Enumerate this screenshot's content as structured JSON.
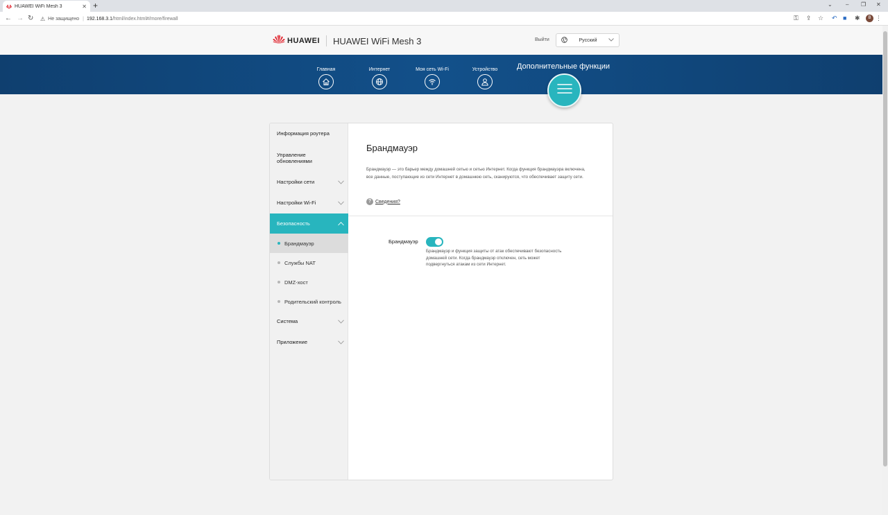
{
  "browser": {
    "tab_title": "HUAWEI WiFi Mesh 3",
    "new_tab": "+",
    "not_secure": "Не защищено",
    "url_host": "192.168.3.1",
    "url_path": "/html/index.html#/more/firewall",
    "profile_initial": "В"
  },
  "header": {
    "brand": "HUAWEI",
    "product": "HUAWEI WiFi Mesh 3",
    "logout": "Выйти",
    "language": "Русский"
  },
  "nav": {
    "items": [
      {
        "label": "Главная",
        "icon": "home-icon"
      },
      {
        "label": "Интернет",
        "icon": "globe-icon"
      },
      {
        "label": "Моя сеть Wi-Fi",
        "icon": "wifi-icon"
      },
      {
        "label": "Устройство",
        "icon": "user-icon"
      }
    ],
    "active": {
      "label": "Дополнительные функции",
      "icon": "menu-icon"
    }
  },
  "sidebar": {
    "items": [
      {
        "label": "Информация роутера",
        "expandable": false
      },
      {
        "label": "Управление обновлениями",
        "expandable": false
      },
      {
        "label": "Настройки сети",
        "expandable": true
      },
      {
        "label": "Настройки Wi-Fi",
        "expandable": true
      },
      {
        "label": "Безопасность",
        "expandable": true,
        "expanded": true,
        "active": true
      },
      {
        "label": "Система",
        "expandable": true
      },
      {
        "label": "Приложение",
        "expandable": true
      }
    ],
    "security_subitems": [
      {
        "label": "Брандмауэр",
        "active": true
      },
      {
        "label": "Службы NAT"
      },
      {
        "label": "DMZ-хост"
      },
      {
        "label": "Родительский контроль"
      }
    ]
  },
  "content": {
    "title": "Брандмауэр",
    "description": "Брандмауэр — это барьер между домашней сетью и сетью Интернет. Когда функция брандмауэра включена, все данные, поступающие из сети Интернет в домашнюю сеть, сканируются, что обеспечивает защиту сети.",
    "help_link": "Сведения?",
    "firewall_label": "Брандмауэр",
    "firewall_enabled": true,
    "firewall_hint": "Брандмауэр и функция защиты от атак обеспечивают безопасность домашней сети. Когда брандмауэр отключен, сеть может подвергнуться атакам из сети Интернет."
  },
  "colors": {
    "accent": "#28b5be",
    "banner": "#12508a",
    "brand_red": "#e0202a"
  }
}
